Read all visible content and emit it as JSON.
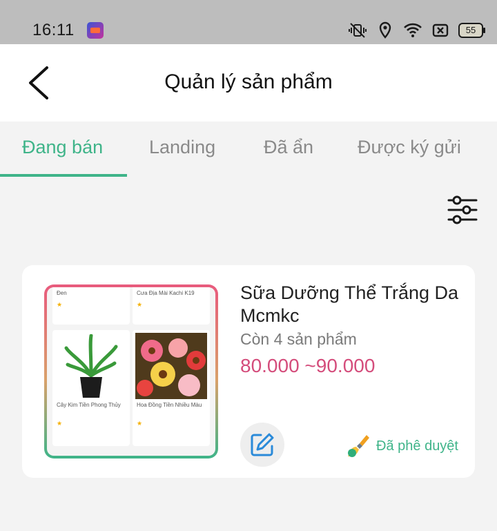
{
  "status_bar": {
    "time": "16:11",
    "battery": "55",
    "icons": [
      "app-icon",
      "vibrate-icon",
      "location-icon",
      "wifi-icon",
      "sim-icon",
      "battery-icon"
    ]
  },
  "header": {
    "title": "Quản lý sản phẩm",
    "back_icon": "back-arrow-icon"
  },
  "tabs": [
    {
      "label": "Đang bán",
      "active": true
    },
    {
      "label": "Landing",
      "active": false
    },
    {
      "label": "Đã ẩn",
      "active": false
    },
    {
      "label": "Được ký gửi",
      "active": false
    }
  ],
  "filter_icon": "filter-sliders-icon",
  "product": {
    "name": "Sữa Dưỡng Thể Trắng Da Mcmkc",
    "stock": "Còn 4 sản phẩm",
    "price": "80.000 ~90.000",
    "status": "Đã phê duyệt",
    "thumbnail": {
      "tiles": [
        {
          "title": "Đen"
        },
        {
          "title": "Cưa Địa Mài Kachi K19"
        },
        {
          "title": "Cây Kim Tiền Phong Thủy"
        },
        {
          "title": "Hoa Đồng Tiền Nhiều Màu"
        }
      ]
    }
  },
  "colors": {
    "accent": "#3fb489",
    "price": "#d44c7b",
    "status_bar_bg": "#bdbdbd"
  }
}
